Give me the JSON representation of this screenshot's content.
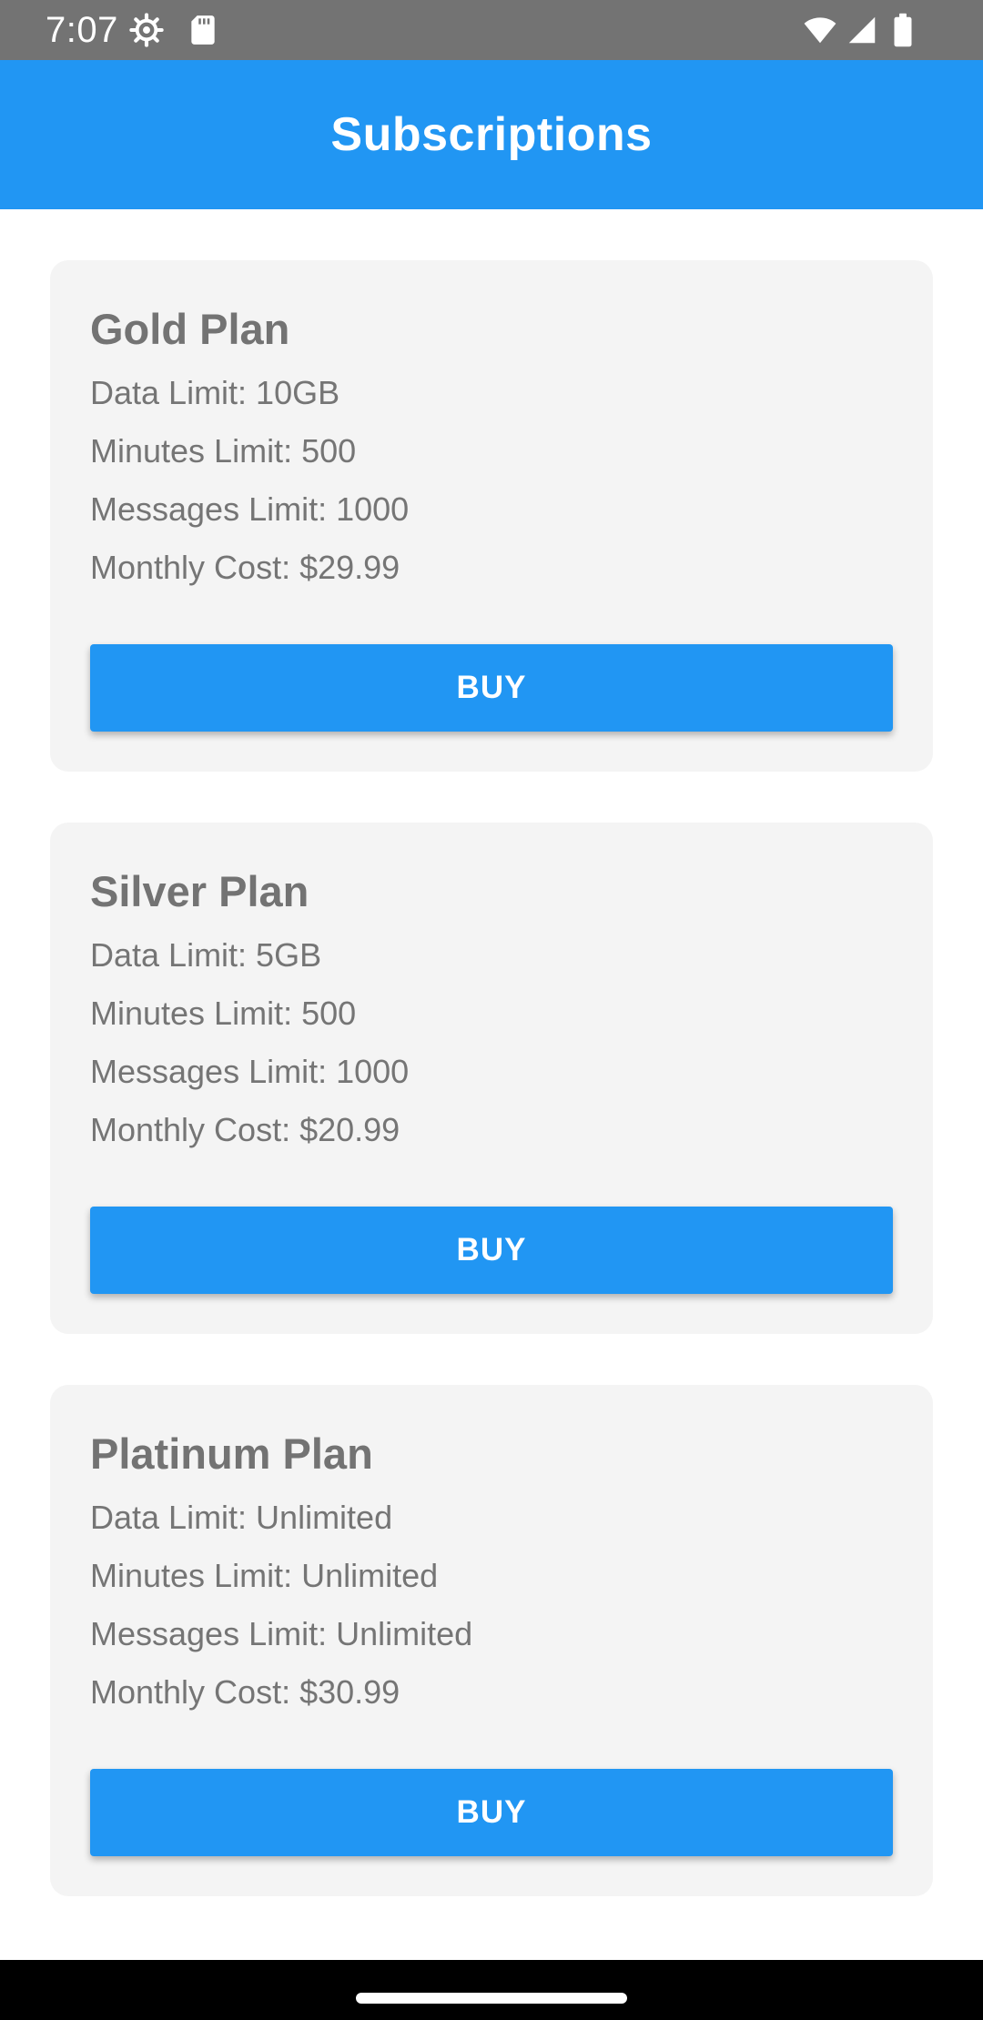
{
  "status_bar": {
    "time": "7:07",
    "icons": [
      "settings-icon",
      "sd-card-icon",
      "wifi-icon",
      "signal-icon",
      "battery-icon"
    ]
  },
  "app_bar": {
    "title": "Subscriptions",
    "color": "#2196f3"
  },
  "plans": [
    {
      "name": "Gold Plan",
      "data_limit": "Data Limit: 10GB",
      "minutes_limit": "Minutes Limit: 500",
      "messages_limit": "Messages Limit: 1000",
      "monthly_cost": "Monthly Cost: $29.99",
      "button_label": "BUY"
    },
    {
      "name": "Silver Plan",
      "data_limit": "Data Limit: 5GB",
      "minutes_limit": "Minutes Limit: 500",
      "messages_limit": "Messages Limit: 1000",
      "monthly_cost": "Monthly Cost: $20.99",
      "button_label": "BUY"
    },
    {
      "name": "Platinum Plan",
      "data_limit": "Data Limit: Unlimited",
      "minutes_limit": "Minutes Limit: Unlimited",
      "messages_limit": "Messages Limit: Unlimited",
      "monthly_cost": "Monthly Cost: $30.99",
      "button_label": "BUY"
    }
  ],
  "colors": {
    "accent": "#2196f3",
    "card_background": "#f4f4f4",
    "status_bar": "#737373",
    "text_secondary": "#757575"
  }
}
